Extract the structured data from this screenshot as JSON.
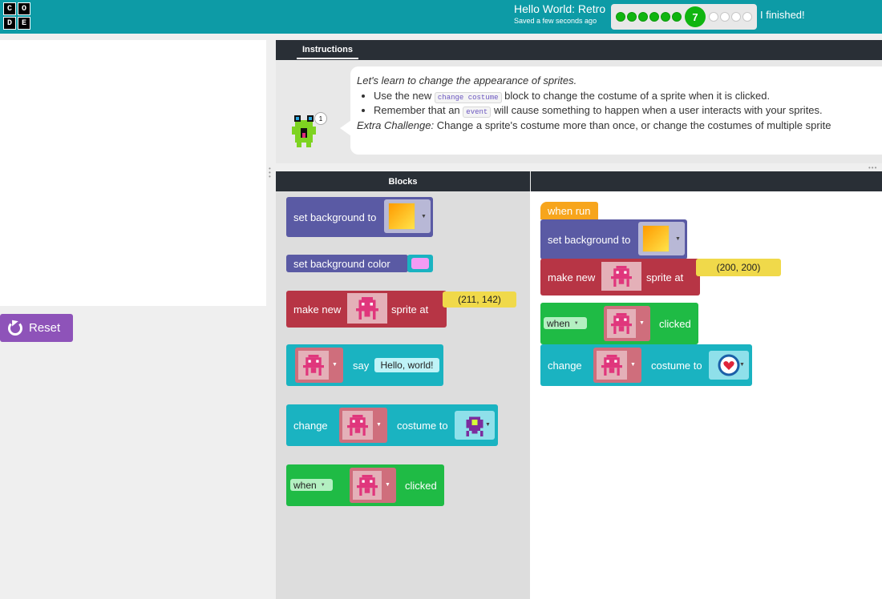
{
  "header": {
    "logo": [
      "C",
      "O",
      "D",
      "E"
    ],
    "project_title": "Hello World: Retro",
    "saved_text": "Saved a few seconds ago",
    "progress": {
      "completed": 6,
      "current": "7",
      "remaining": 4
    },
    "finished_label": "I finished!"
  },
  "reset": {
    "label": "Reset"
  },
  "instructions": {
    "tab_label": "Instructions",
    "intro": "Let's learn to change the appearance of sprites.",
    "bullet1_pre": "Use the new",
    "bullet1_code": "change costume",
    "bullet1_post": "block to change the costume of a sprite when it is clicked.",
    "bullet2_pre": "Remember that an",
    "bullet2_code": "event",
    "bullet2_post": "will cause something to happen when a user interacts with your sprites.",
    "extra_label": "Extra Challenge:",
    "extra_text": "Change a sprite's costume more than once, or change the costumes of multiple sprite",
    "badge": "1"
  },
  "toolbox": {
    "header": "Blocks",
    "set_background": "set background to",
    "set_background_color": "set background color",
    "make_new": "make new",
    "sprite_at": "sprite at",
    "make_new_coord": "(211, 142)",
    "say": "say",
    "say_text": "Hello, world!",
    "change": "change",
    "costume_to": "costume to",
    "when": "when",
    "clicked": "clicked"
  },
  "workspace": {
    "when_run": "when run",
    "set_background": "set background to",
    "make_new": "make new",
    "sprite_at": "sprite at",
    "coord": "(200, 200)",
    "when": "when",
    "clicked": "clicked",
    "change": "change",
    "costume_to": "costume to"
  },
  "colors": {
    "header": "#0d9ba6",
    "purple_block": "#5a5aa4",
    "red_block": "#b73545",
    "teal_block": "#1ab3c1",
    "green_block": "#1fbb45",
    "orange_block": "#f7a51c",
    "progress_done": "#10b510",
    "reset_button": "#8e53b9"
  }
}
